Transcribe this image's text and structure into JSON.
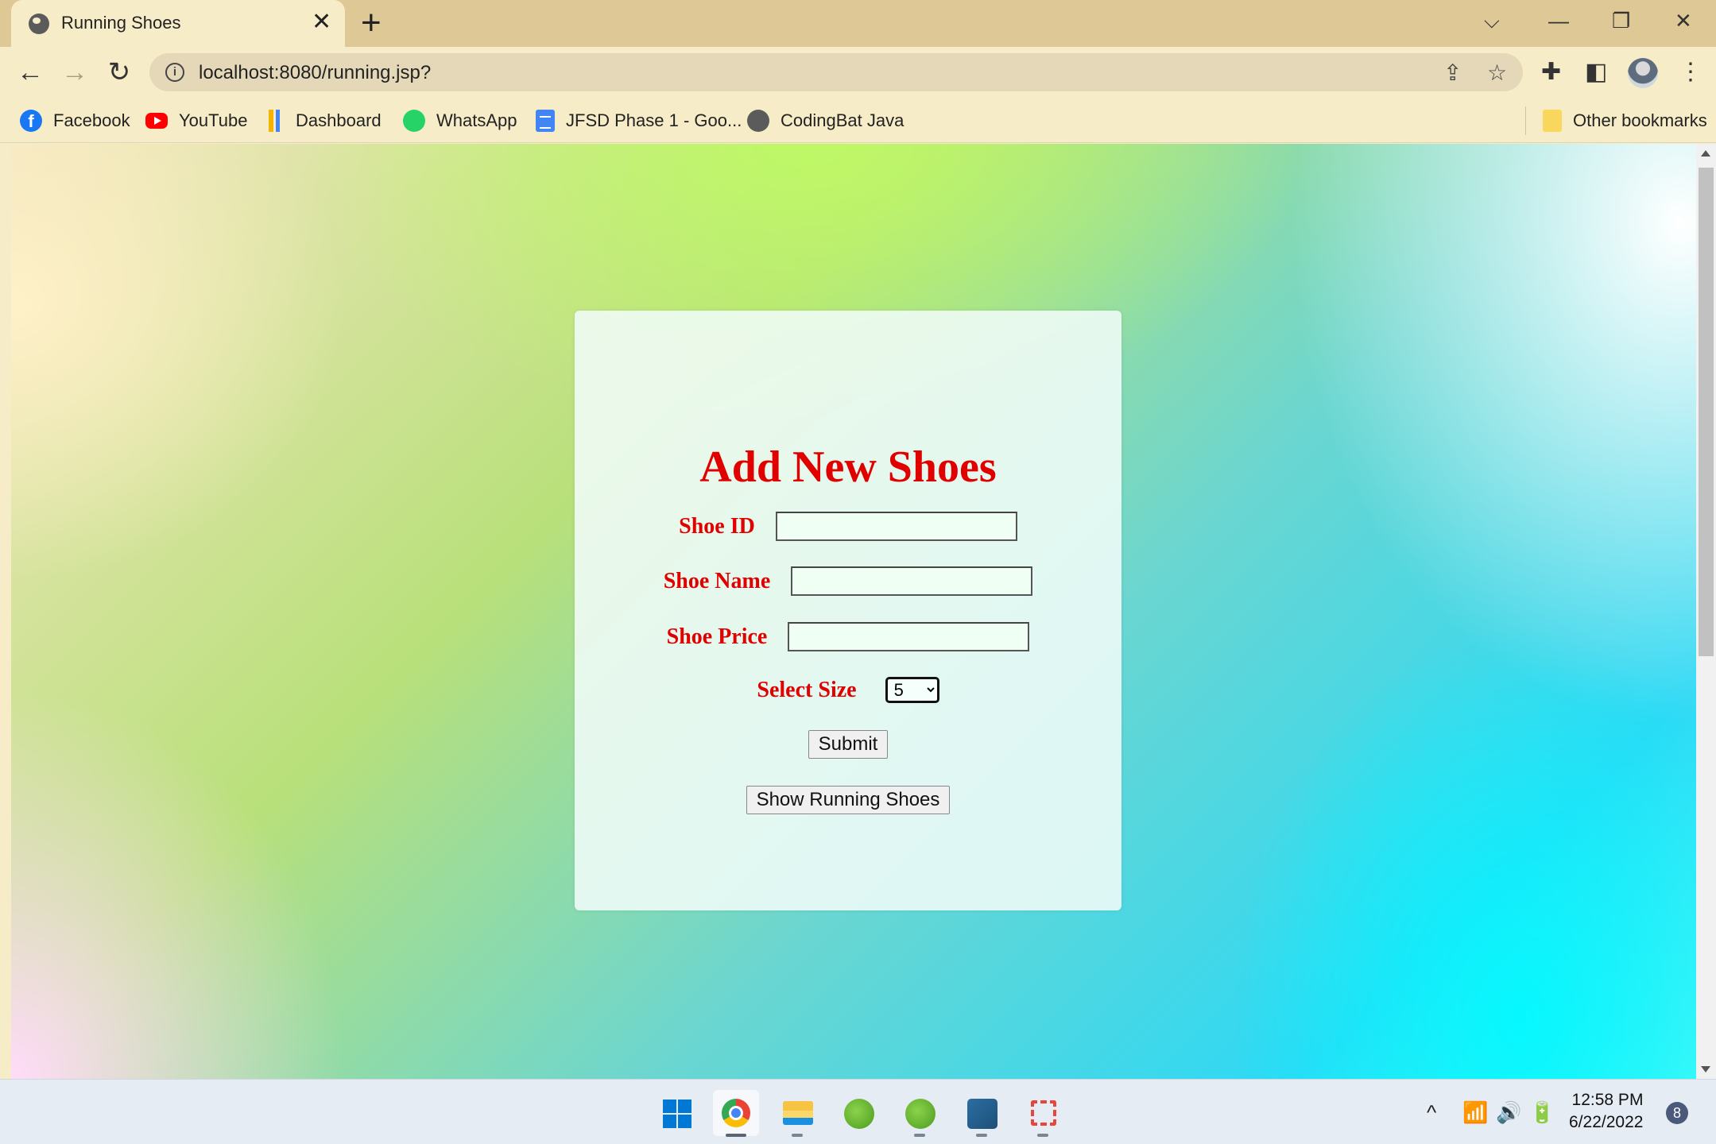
{
  "browser": {
    "tab": {
      "title": "Running Shoes",
      "close_glyph": "✕"
    },
    "new_tab_glyph": "+",
    "window_controls": {
      "tab_search": "⌵",
      "minimize": "—",
      "restore": "❐",
      "close": "✕"
    },
    "nav": {
      "back": "←",
      "forward": "→",
      "reload": "↻"
    },
    "address_bar": {
      "url": "localhost:8080/running.jsp?",
      "info_glyph": "i"
    },
    "omnibox_icons": {
      "share": "⇪",
      "bookmark_star": "☆"
    },
    "toolbar_icons": {
      "extensions": "✚",
      "side_panel": "◧",
      "menu": "⋮"
    },
    "bookmarks": [
      {
        "label": "Facebook",
        "icon": "facebook-icon"
      },
      {
        "label": "YouTube",
        "icon": "youtube-icon"
      },
      {
        "label": "Dashboard",
        "icon": "dashboard-icon"
      },
      {
        "label": "WhatsApp",
        "icon": "whatsapp-icon"
      },
      {
        "label": "JFSD Phase 1 - Goo...",
        "icon": "google-docs-icon"
      },
      {
        "label": "CodingBat Java",
        "icon": "globe-icon"
      }
    ],
    "other_bookmarks": "Other bookmarks"
  },
  "form": {
    "heading": "Add New Shoes",
    "fields": {
      "shoe_id": {
        "label": "Shoe ID",
        "value": ""
      },
      "shoe_name": {
        "label": "Shoe Name",
        "value": ""
      },
      "shoe_price": {
        "label": "Shoe Price",
        "value": ""
      },
      "size": {
        "label": "Select Size",
        "selected": "5"
      }
    },
    "submit_label": "Submit",
    "show_label": "Show Running Shoes",
    "colors": {
      "label": "#e00000",
      "heading": "#e00000"
    }
  },
  "taskbar": {
    "apps": [
      "start-icon",
      "chrome-icon",
      "file-explorer-icon",
      "spring-tool-suite-icon",
      "spring-tool-suite-icon",
      "mysql-workbench-icon",
      "snipping-tool-icon"
    ],
    "tray": {
      "chevron": "^",
      "wifi": "wifi-icon",
      "volume": "volume-icon",
      "battery": "battery-icon"
    },
    "time": "12:58 PM",
    "date": "6/22/2022",
    "notifications": "8"
  }
}
